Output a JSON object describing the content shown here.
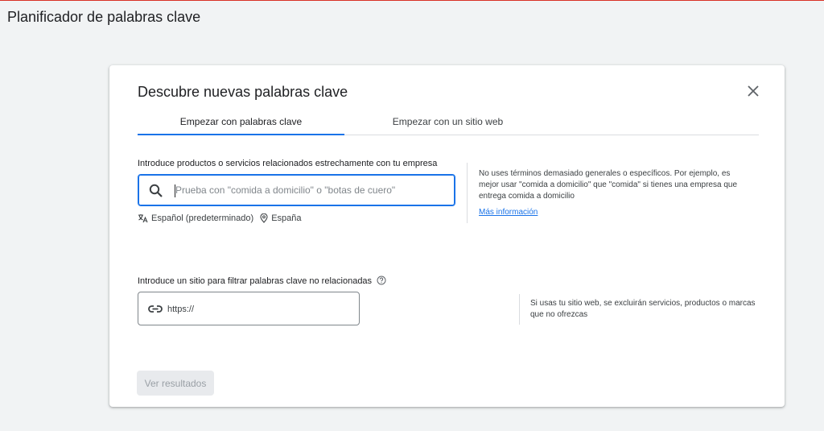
{
  "page": {
    "title": "Planificador de palabras clave"
  },
  "dialog": {
    "title": "Descubre nuevas palabras clave",
    "tabs": [
      {
        "label": "Empezar con palabras clave",
        "active": true
      },
      {
        "label": "Empezar con un sitio web",
        "active": false
      }
    ],
    "keywords": {
      "label": "Introduce productos o servicios relacionados estrechamente con tu empresa",
      "placeholder": "Prueba con \"comida a domicilio\" o \"botas de cuero\"",
      "language": "Español (predeterminado)",
      "location": "España",
      "help": "No uses términos demasiado generales o específicos. Por ejemplo, es mejor usar \"comida a domicilio\" que \"comida\" si tienes una empresa que entrega comida a domicilio",
      "help_link": "Más información"
    },
    "site_filter": {
      "label": "Introduce un sitio para filtrar palabras clave no relacionadas",
      "value": "https://",
      "help": "Si usas tu sitio web, se excluirán servicios, productos o marcas que no ofrezcas"
    },
    "submit_label": "Ver resultados"
  },
  "colors": {
    "accent": "#1a73e8",
    "top_bar": "#d93025",
    "disabled": "#e8eaed"
  },
  "icons": [
    "close-icon",
    "search-icon",
    "translate-icon",
    "location-pin-icon",
    "link-icon",
    "help-circle-icon"
  ]
}
